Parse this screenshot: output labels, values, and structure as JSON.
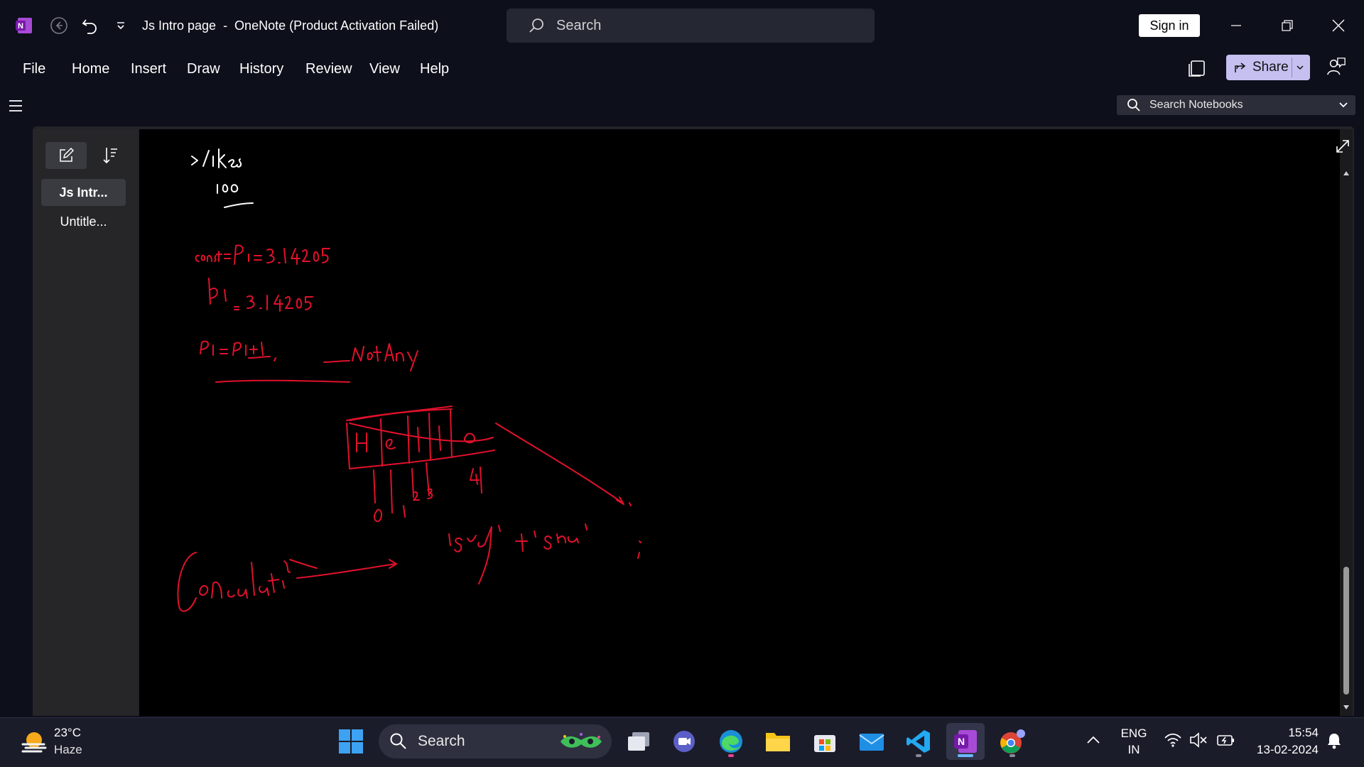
{
  "titlebar": {
    "title": "Js Intro page  -  OneNote (Product Activation Failed)",
    "search_placeholder": "Search",
    "sign_in_label": "Sign in"
  },
  "menu": {
    "items": [
      "File",
      "Home",
      "Insert",
      "Draw",
      "History",
      "Review",
      "View",
      "Help"
    ],
    "share_label": "Share"
  },
  "notebook_search": {
    "placeholder": "Search Notebooks"
  },
  "pages": [
    {
      "label": "Js Intr...",
      "active": true
    },
    {
      "label": "Untitle...",
      "active": false
    }
  ],
  "colors": {
    "ink": "#e0112b",
    "ink_white": "#ffffff",
    "accent": "#c5c0f0",
    "onenote_purple": "#7719aa"
  },
  "taskbar": {
    "weather_temp": "23°C",
    "weather_condition": "Haze",
    "search_label": "Search",
    "language_top": "ENG",
    "language_bottom": "IN",
    "time": "15:54",
    "date": "13-02-2024"
  }
}
